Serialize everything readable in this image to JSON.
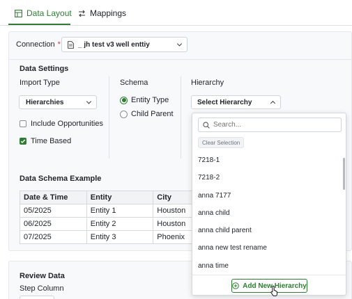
{
  "tabs": [
    {
      "label": "Data Layout",
      "icon": "table-icon",
      "active": true
    },
    {
      "label": "Mappings",
      "icon": "swap-arrows-icon",
      "active": false
    }
  ],
  "connection": {
    "label": "Connection",
    "required_mark": "*",
    "value": "_ jh test v3 well enttiy",
    "icon": "document-icon"
  },
  "data_settings": {
    "title": "Data Settings",
    "import_type": {
      "label": "Import Type",
      "value": "Hierarchies",
      "include_opportunities": {
        "label": "Include Opportunities",
        "checked": false
      },
      "time_based": {
        "label": "Time Based",
        "checked": true
      }
    },
    "schema": {
      "label": "Schema",
      "options": [
        {
          "label": "Entity Type",
          "selected": true
        },
        {
          "label": "Child Parent",
          "selected": false
        }
      ]
    },
    "hierarchy": {
      "label": "Hierarchy",
      "value": "Select Hierarchy"
    }
  },
  "schema_example": {
    "title": "Data Schema Example",
    "headers": [
      "Date & Time",
      "Entity",
      "City"
    ],
    "rows": [
      [
        "05/2025",
        "Entity 1",
        "Houston"
      ],
      [
        "06/2025",
        "Entity 2",
        "Houston"
      ],
      [
        "07/2025",
        "Entity 3",
        "Phoenix"
      ]
    ]
  },
  "review": {
    "title": "Review Data",
    "step_column_label": "Step Column"
  },
  "hierarchy_dropdown": {
    "search_placeholder": "Search...",
    "clear_label": "Clear Selection",
    "items": [
      "7218-1",
      "7218-2",
      "anna 7177",
      "anna child",
      "anna child parent",
      "anna new test rename",
      "anna time"
    ],
    "add_label": "Add New Hierarchy"
  },
  "colors": {
    "accent": "#2e7d32",
    "border": "#d6d9dc",
    "panel": "#f8f9fa"
  }
}
